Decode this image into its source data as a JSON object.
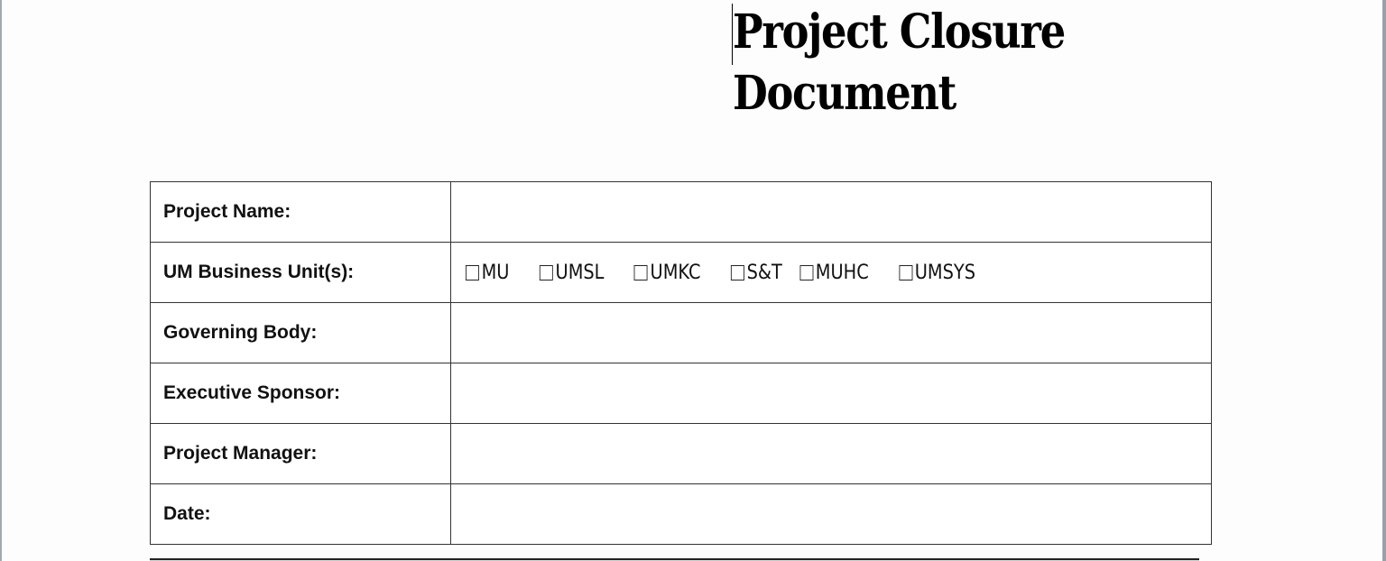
{
  "document": {
    "title_line1": "Project Closure",
    "title_line2": "Document"
  },
  "form": {
    "rows": [
      {
        "label": "Project Name:",
        "value": ""
      },
      {
        "label": "UM Business Unit(s):",
        "value": ""
      },
      {
        "label": "Governing Body:",
        "value": ""
      },
      {
        "label": "Executive Sponsor:",
        "value": ""
      },
      {
        "label": "Project Manager:",
        "value": ""
      },
      {
        "label": "Date:",
        "value": ""
      }
    ],
    "business_units": [
      {
        "label": "MU",
        "checked": false
      },
      {
        "label": "UMSL",
        "checked": false
      },
      {
        "label": "UMKC",
        "checked": false
      },
      {
        "label": "S&T",
        "checked": false
      },
      {
        "label": "MUHC",
        "checked": false
      },
      {
        "label": "UMSYS",
        "checked": false
      }
    ]
  }
}
